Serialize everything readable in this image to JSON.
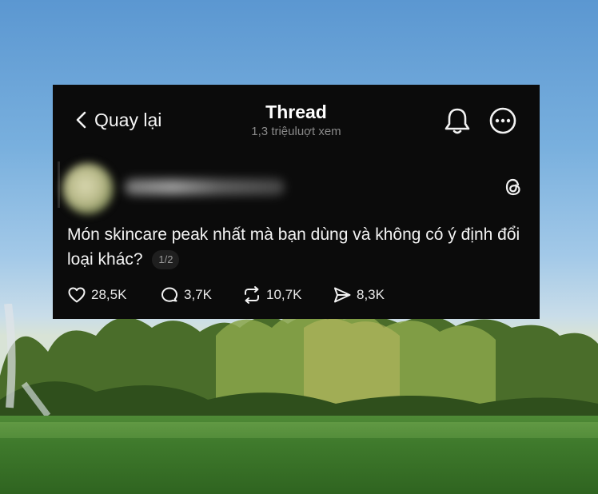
{
  "header": {
    "back_label": "Quay lại",
    "title": "Thread",
    "views": "1,3 triệuluợt xem"
  },
  "post": {
    "text": "Món skincare peak nhất mà bạn dùng và không có ý định đổi loại khác?",
    "page_indicator": "1/2"
  },
  "actions": {
    "likes": "28,5K",
    "replies": "3,7K",
    "reposts": "10,7K",
    "shares": "8,3K"
  },
  "icons": {
    "back": "chevron-left-icon",
    "notifications": "bell-icon",
    "more": "more-circle-icon",
    "brand": "threads-logo-icon",
    "like": "heart-icon",
    "reply": "speech-bubble-icon",
    "repost": "repost-icon",
    "share": "send-icon"
  },
  "colors": {
    "card_background": "#0b0b0b",
    "text": "#f2f2f2",
    "muted_text": "#8a8a8a"
  }
}
